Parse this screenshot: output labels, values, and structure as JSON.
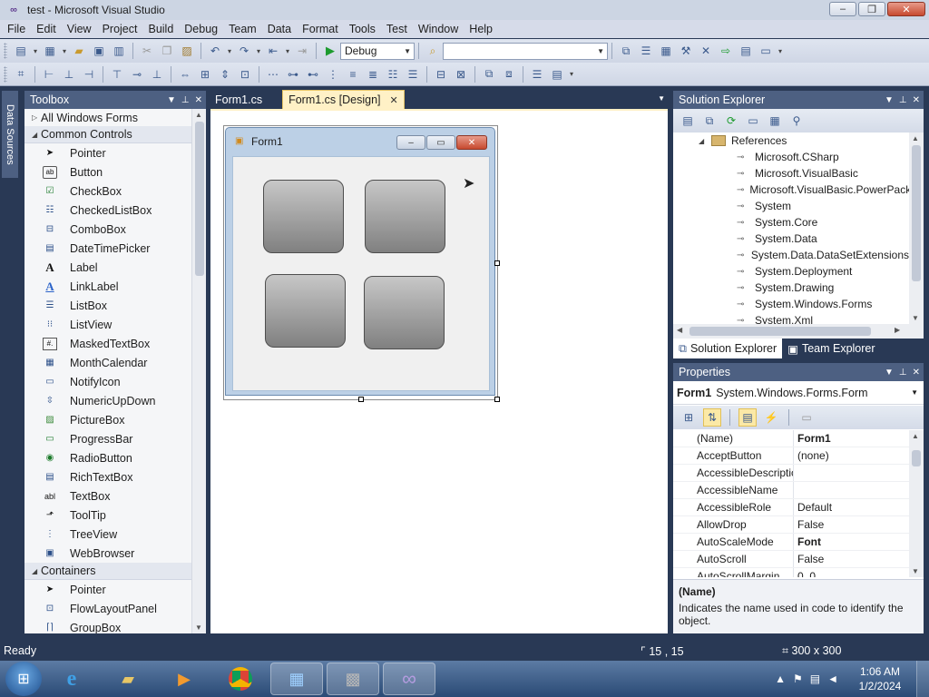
{
  "window": {
    "title": "test - Microsoft Visual Studio",
    "app_icon": "vs-infinity-icon",
    "buttons": [
      "minimize",
      "maximize",
      "close"
    ]
  },
  "menu": [
    "File",
    "Edit",
    "View",
    "Project",
    "Build",
    "Debug",
    "Team",
    "Data",
    "Format",
    "Tools",
    "Test",
    "Window",
    "Help"
  ],
  "toolbar": {
    "config_value": "Debug",
    "platform_value": ""
  },
  "left_strip": {
    "tab_label": "Data Sources"
  },
  "toolbox": {
    "header": "Toolbox",
    "categories": [
      {
        "label": "All Windows Forms",
        "expanded": false
      },
      {
        "label": "Common Controls",
        "expanded": true
      }
    ],
    "items": [
      {
        "label": "Pointer",
        "icon": "pointer-icon"
      },
      {
        "label": "Button",
        "icon": "button-icon"
      },
      {
        "label": "CheckBox",
        "icon": "checkbox-icon"
      },
      {
        "label": "CheckedListBox",
        "icon": "checkedlistbox-icon"
      },
      {
        "label": "ComboBox",
        "icon": "combobox-icon"
      },
      {
        "label": "DateTimePicker",
        "icon": "datetimepicker-icon"
      },
      {
        "label": "Label",
        "icon": "label-icon"
      },
      {
        "label": "LinkLabel",
        "icon": "linklabel-icon"
      },
      {
        "label": "ListBox",
        "icon": "listbox-icon"
      },
      {
        "label": "ListView",
        "icon": "listview-icon"
      },
      {
        "label": "MaskedTextBox",
        "icon": "maskedtextbox-icon"
      },
      {
        "label": "MonthCalendar",
        "icon": "monthcalendar-icon"
      },
      {
        "label": "NotifyIcon",
        "icon": "notifyicon-icon"
      },
      {
        "label": "NumericUpDown",
        "icon": "numericupdown-icon"
      },
      {
        "label": "PictureBox",
        "icon": "picturebox-icon"
      },
      {
        "label": "ProgressBar",
        "icon": "progressbar-icon"
      },
      {
        "label": "RadioButton",
        "icon": "radiobutton-icon"
      },
      {
        "label": "RichTextBox",
        "icon": "richtextbox-icon"
      },
      {
        "label": "TextBox",
        "icon": "textbox-icon"
      },
      {
        "label": "ToolTip",
        "icon": "tooltip-icon"
      },
      {
        "label": "TreeView",
        "icon": "treeview-icon"
      },
      {
        "label": "WebBrowser",
        "icon": "webbrowser-icon"
      }
    ],
    "containers": {
      "label": "Containers",
      "items": [
        "Pointer",
        "FlowLayoutPanel",
        "GroupBox"
      ]
    }
  },
  "doc_tabs": [
    {
      "label": "Form1.cs",
      "active": false
    },
    {
      "label": "Form1.cs [Design]",
      "active": true
    }
  ],
  "designer": {
    "form_title": "Form1"
  },
  "solution_explorer": {
    "header": "Solution Explorer",
    "folder": "References",
    "references": [
      "Microsoft.CSharp",
      "Microsoft.VisualBasic",
      "Microsoft.VisualBasic.PowerPack",
      "System",
      "System.Core",
      "System.Data",
      "System.Data.DataSetExtensions",
      "System.Deployment",
      "System.Drawing",
      "System.Windows.Forms",
      "System.Xml"
    ],
    "tabs": [
      "Solution Explorer",
      "Team Explorer"
    ]
  },
  "properties": {
    "header": "Properties",
    "object_name": "Form1",
    "object_type": "System.Windows.Forms.Form",
    "rows": [
      {
        "name": "(Name)",
        "value": "Form1",
        "bold": true
      },
      {
        "name": "AcceptButton",
        "value": "(none)",
        "bold": false
      },
      {
        "name": "AccessibleDescriptic",
        "value": "",
        "bold": false
      },
      {
        "name": "AccessibleName",
        "value": "",
        "bold": false
      },
      {
        "name": "AccessibleRole",
        "value": "Default",
        "bold": false
      },
      {
        "name": "AllowDrop",
        "value": "False",
        "bold": false
      },
      {
        "name": "AutoScaleMode",
        "value": "Font",
        "bold": true
      },
      {
        "name": "AutoScroll",
        "value": "False",
        "bold": false
      },
      {
        "name": "AutoScrollMargin",
        "value": "0, 0",
        "bold": false
      }
    ],
    "desc_title": "(Name)",
    "desc_text": "Indicates the name used in code to identify the object."
  },
  "status": {
    "text": "Ready",
    "position": "15 , 15",
    "size": "300 x 300"
  },
  "taskbar": {
    "apps": [
      "internet-explorer-icon",
      "file-explorer-icon",
      "media-player-icon",
      "chrome-icon",
      "remote-desktop-icon",
      "firewall-icon",
      "visual-studio-icon"
    ],
    "time": "1:06 AM",
    "date": "1/2/2024"
  }
}
